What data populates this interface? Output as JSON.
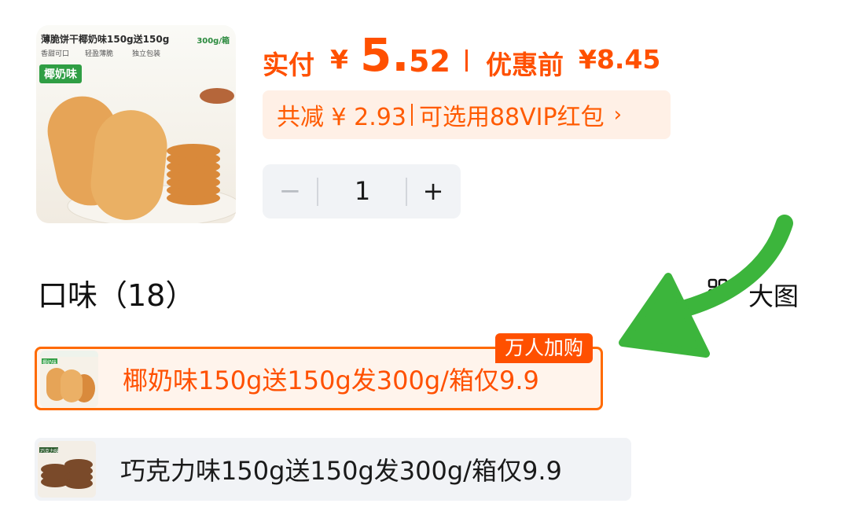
{
  "product": {
    "thumb_title": "薄脆饼干椰奶味150g送150g",
    "thumb_weight": "300g/箱",
    "thumb_features": [
      "香甜可口",
      "轻盈薄脆",
      "独立包装"
    ],
    "thumb_flavor_tag": "椰奶味"
  },
  "price": {
    "pay_label": "实付",
    "currency": "¥",
    "pay_int": "5.",
    "pay_dec": "52",
    "before_label": "优惠前",
    "before_value": "¥8.45"
  },
  "discount": {
    "reduce_text": "共减 ¥ 2.93",
    "vip_text": "可选用88VIP红包",
    "chevron": "›"
  },
  "stepper": {
    "minus": "−",
    "quantity": "1",
    "plus": "+"
  },
  "flavors": {
    "title": "口味（18）",
    "big_image_label": "大图",
    "options": [
      {
        "label": "椰奶味150g送150g发300g/箱仅9.9",
        "badge": "万人加购",
        "selected": true,
        "thumb_tag": "椰奶味"
      },
      {
        "label": "巧克力味150g送150g发300g/箱仅9.9",
        "selected": false,
        "thumb_tag": "巧克力味"
      }
    ]
  },
  "colors": {
    "accent": "#ff5000",
    "annotation_arrow": "#3cb53c"
  }
}
